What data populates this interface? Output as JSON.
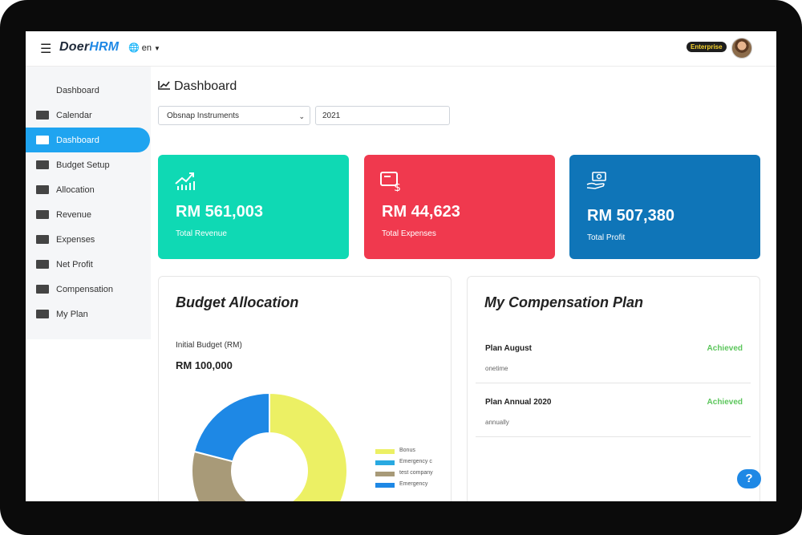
{
  "header": {
    "brand_prefix": "Doer",
    "brand_suffix": "HRM",
    "language": "en",
    "plan_badge": "Enterprise"
  },
  "sidebar": {
    "items": [
      {
        "label": "Dashboard",
        "icon": "none"
      },
      {
        "label": "Calendar",
        "icon": "card-icon"
      },
      {
        "label": "Dashboard",
        "icon": "card-icon",
        "active": true
      },
      {
        "label": "Budget Setup",
        "icon": "card-icon"
      },
      {
        "label": "Allocation",
        "icon": "card-icon"
      },
      {
        "label": "Revenue",
        "icon": "card-icon"
      },
      {
        "label": "Expenses",
        "icon": "card-icon"
      },
      {
        "label": "Net Profit",
        "icon": "card-icon"
      },
      {
        "label": "Compensation",
        "icon": "card-icon"
      },
      {
        "label": "My Plan",
        "icon": "card-icon"
      }
    ]
  },
  "main": {
    "title": "Dashboard",
    "company_select": "Obsnap Instruments",
    "year": "2021"
  },
  "cards": [
    {
      "amount": "RM 561,003",
      "label": "Total Revenue",
      "color": "#0fd9b4",
      "icon": "growth-chart-icon"
    },
    {
      "amount": "RM 44,623",
      "label": "Total Expenses",
      "color": "#f0394e",
      "icon": "invoice-dollar-icon"
    },
    {
      "amount": "RM 507,380",
      "label": "Total Profit",
      "color": "#0f75b8",
      "icon": "money-hand-icon"
    }
  ],
  "budget": {
    "title": "Budget Allocation",
    "initial_label": "Initial Budget (RM)",
    "initial_amount": "RM 100,000"
  },
  "chart_data": {
    "type": "pie",
    "categories": [
      "Bonus",
      "Emergency c",
      "test company",
      "Emergency"
    ],
    "values": [
      52,
      3,
      24,
      21
    ],
    "colors": [
      "#ecf064",
      "#29a9e1",
      "#a89a78",
      "#1e88e5"
    ],
    "title": "",
    "legend": "right"
  },
  "compensation": {
    "title": "My Compensation Plan",
    "plans": [
      {
        "name": "Plan August",
        "type": "onetime",
        "status": "Achieved"
      },
      {
        "name": "Plan Annual 2020",
        "type": "annually",
        "status": "Achieved"
      }
    ]
  },
  "help_label": "?"
}
